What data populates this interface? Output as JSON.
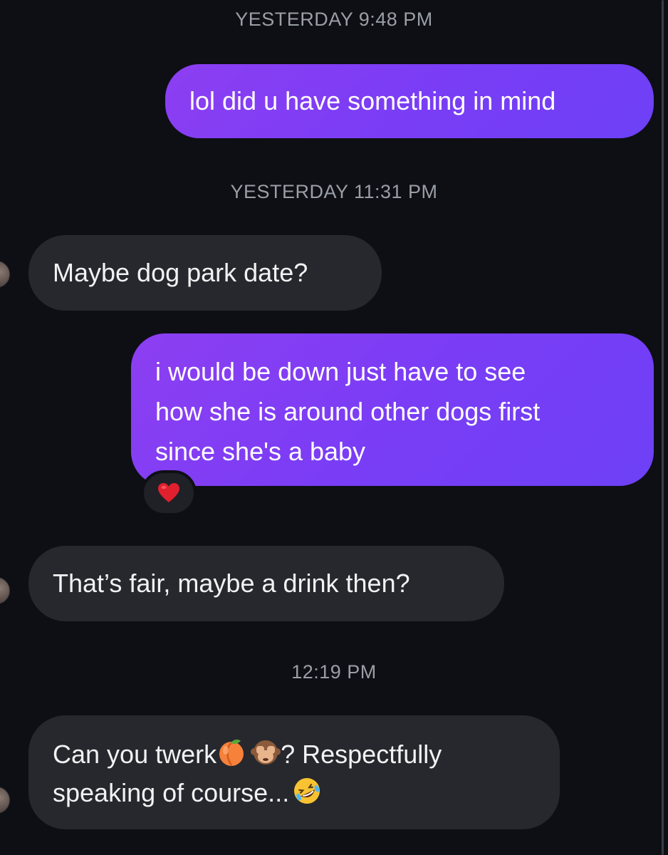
{
  "messages": {
    "ts1": "YESTERDAY 9:48 PM",
    "sent1": "lol did u have something in mind",
    "ts2": "YESTERDAY 11:31 PM",
    "recv1": "Maybe dog park date?",
    "sent2_line1": "i would be down just have to see",
    "sent2_line2": "how she is around other dogs first",
    "sent2_line3": "since she's a baby",
    "reaction": "heart-icon",
    "recv2": "That’s fair, maybe a drink then?",
    "ts3": "12:19 PM",
    "recv3_part1": "Can you twerk",
    "recv3_part2": "? Respectfully",
    "recv3_line2": "speaking of course...",
    "emoji_1": "peach-emoji-icon",
    "emoji_2": "see-no-evil-monkey-emoji-icon",
    "emoji_3": "rolling-laughing-emoji-icon"
  },
  "colors": {
    "background": "#0d0f14",
    "sent_bubble": "#7a3df5",
    "received_bubble": "#26282d",
    "timestamp": "#9a9ea6",
    "reaction_heart": "#e0202e"
  }
}
